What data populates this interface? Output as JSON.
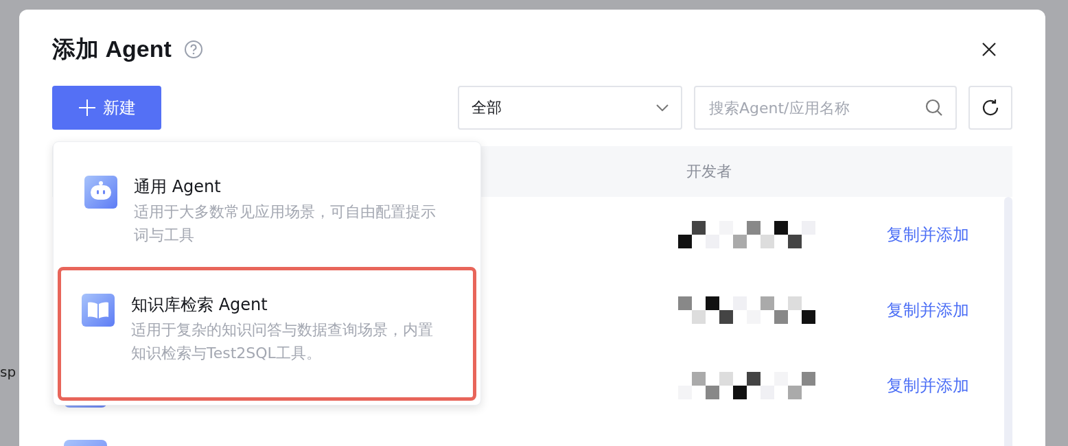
{
  "background": {
    "fragments": [
      "sp"
    ]
  },
  "dialog": {
    "title": "添加 Agent",
    "new_button": "新建",
    "filter": {
      "value": "全部"
    },
    "search": {
      "placeholder": "搜索Agent/应用名称"
    }
  },
  "menu": {
    "items": [
      {
        "kind": "robot",
        "title": "通用 Agent",
        "description": "适用于大多数常见应用场景，可自由配置提示词与工具",
        "highlighted": false
      },
      {
        "kind": "book",
        "title": "知识库检索 Agent",
        "description": "适用于复杂的知识问答与数据查询场景，内置知识检索与Test2SQL工具。",
        "highlighted": true
      }
    ]
  },
  "table": {
    "columns": [
      "开发者"
    ],
    "rows": [
      {
        "action": "复制并添加",
        "avatar": false
      },
      {
        "action": "复制并添加",
        "avatar": false
      },
      {
        "action": "复制并添加",
        "avatar": true
      },
      {
        "avatar": true
      }
    ]
  }
}
